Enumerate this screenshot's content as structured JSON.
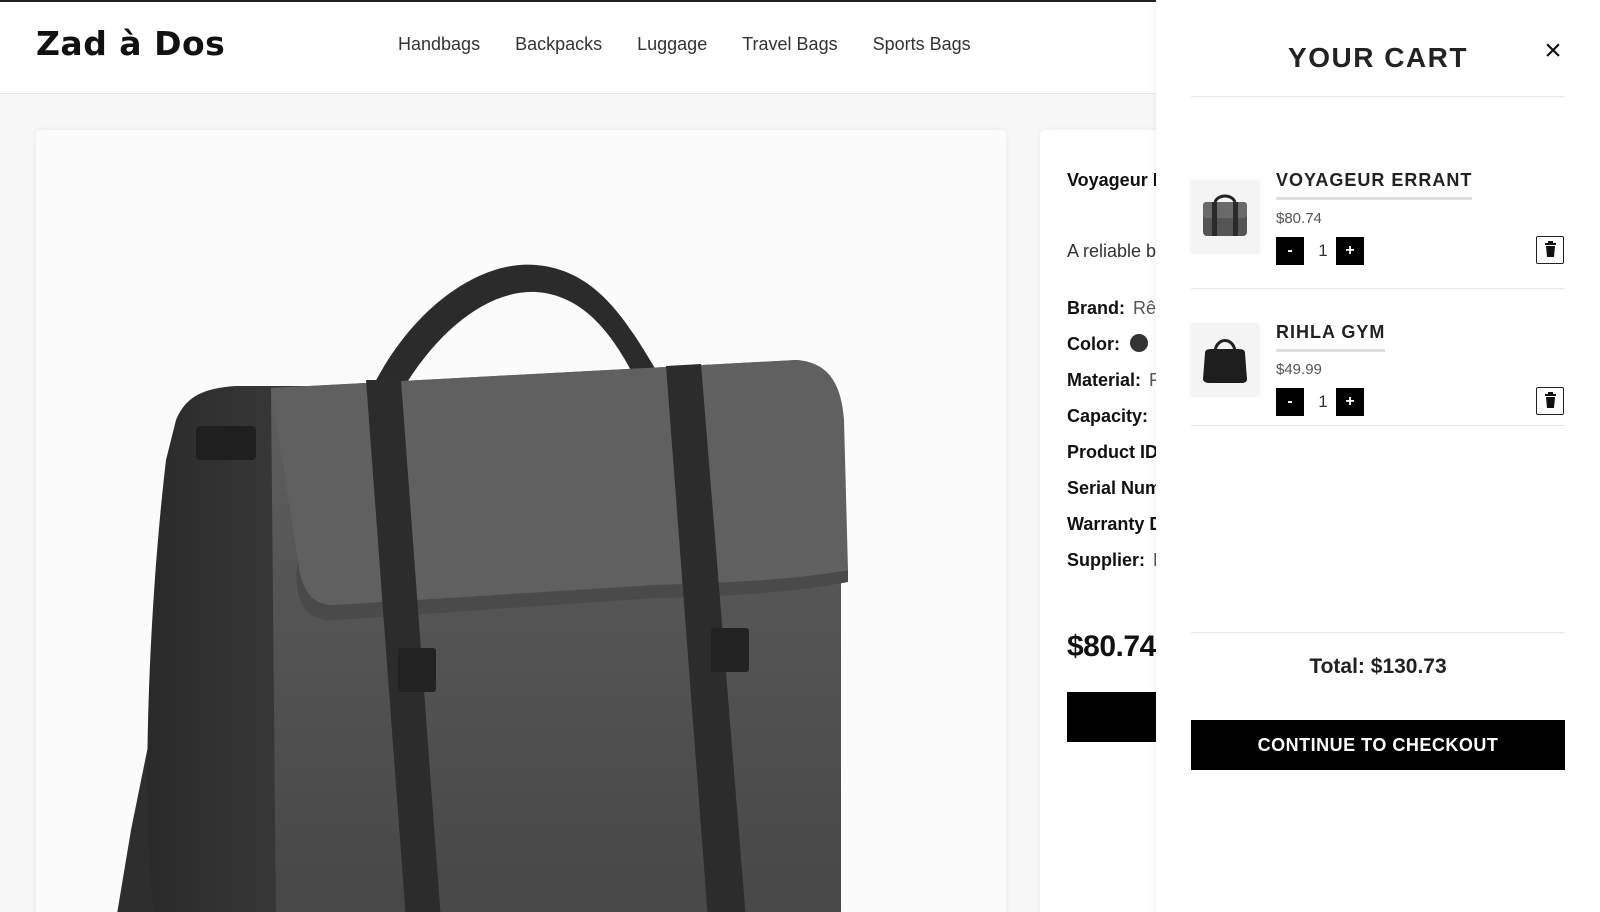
{
  "brand": {
    "logo": "Zad à Dos"
  },
  "nav": [
    "Handbags",
    "Backpacks",
    "Luggage",
    "Travel Bags",
    "Sports Bags"
  ],
  "product": {
    "name": "Voyageur I",
    "description": "A reliable b",
    "specs": [
      {
        "label": "Brand:",
        "value": "Rê"
      },
      {
        "label": "Color:",
        "value": ""
      },
      {
        "label": "Material:",
        "value": "F"
      },
      {
        "label": "Capacity:",
        "value": ""
      },
      {
        "label": "Product ID",
        "value": ""
      },
      {
        "label": "Serial Num",
        "value": ""
      },
      {
        "label": "Warranty D",
        "value": ""
      },
      {
        "label": "Supplier:",
        "value": "E"
      }
    ],
    "price": "$80.74",
    "color_swatch": "#333333"
  },
  "cart": {
    "title": "YOUR CART",
    "close_icon": "×",
    "items": [
      {
        "name": "VOYAGEUR ERRANT",
        "price": "$80.74",
        "qty": "1",
        "minus": "-",
        "plus": "+"
      },
      {
        "name": "RIHLA GYM",
        "price": "$49.99",
        "qty": "1",
        "minus": "-",
        "plus": "+"
      }
    ],
    "total": "Total: $130.73",
    "checkout_label": "CONTINUE TO CHECKOUT"
  },
  "colors": {
    "accent": "#000000",
    "bag": "#5a5a5a",
    "strap": "#2c2c2c"
  }
}
